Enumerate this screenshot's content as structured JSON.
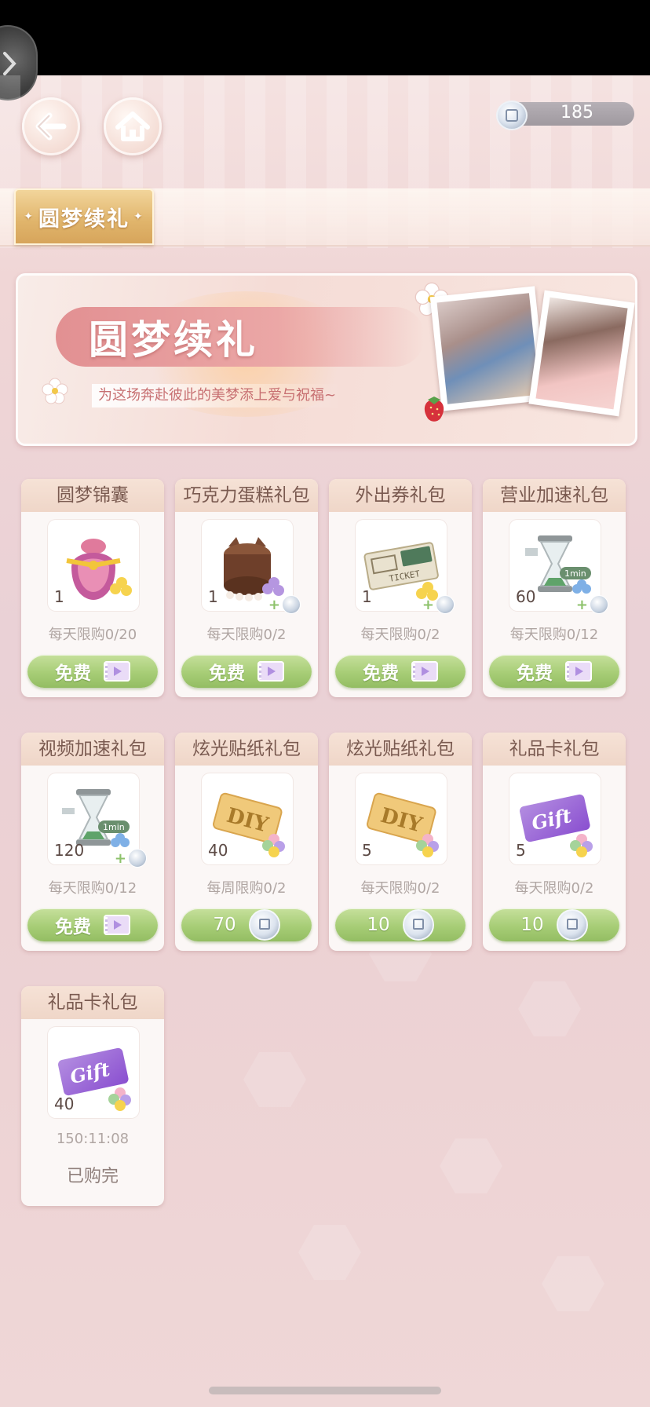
{
  "header": {
    "coins": "185"
  },
  "tab": {
    "active_label": "圆梦续礼"
  },
  "banner": {
    "title": "圆梦续礼",
    "subtitle": "为这场奔赴彼此的美梦添上爱与祝福~"
  },
  "cards": [
    {
      "title": "圆梦锦囊",
      "count": "1",
      "limit": "每天限购0/20",
      "action": "免费",
      "action_type": "video",
      "bonus": false
    },
    {
      "title": "巧克力蛋糕礼包",
      "count": "1",
      "limit": "每天限购0/2",
      "action": "免费",
      "action_type": "video",
      "bonus": true
    },
    {
      "title": "外出券礼包",
      "count": "1",
      "limit": "每天限购0/2",
      "action": "免费",
      "action_type": "video",
      "bonus": true
    },
    {
      "title": "营业加速礼包",
      "count": "60",
      "limit": "每天限购0/12",
      "action": "免费",
      "action_type": "video",
      "bonus": true
    },
    {
      "title": "视频加速礼包",
      "count": "120",
      "limit": "每天限购0/12",
      "action": "免费",
      "action_type": "video",
      "bonus": true
    },
    {
      "title": "炫光贴纸礼包",
      "count": "40",
      "limit": "每周限购0/2",
      "action": "70",
      "action_type": "coin",
      "bonus": false
    },
    {
      "title": "炫光贴纸礼包",
      "count": "5",
      "limit": "每天限购0/2",
      "action": "10",
      "action_type": "coin",
      "bonus": false
    },
    {
      "title": "礼品卡礼包",
      "count": "5",
      "limit": "每天限购0/2",
      "action": "10",
      "action_type": "coin",
      "bonus": false
    },
    {
      "title": "礼品卡礼包",
      "count": "40",
      "timer": "150:11:08",
      "status": "已购完",
      "action_type": "sold",
      "bonus": false
    }
  ],
  "item_art": {
    "hourglass_label": "1min",
    "ticket_label": "TICKET",
    "diy_label": "DIY",
    "gift_label": "Gift"
  },
  "icons": {
    "back": "back-arrow-icon",
    "home": "home-icon",
    "coin": "coin-icon",
    "video": "video-ad-icon"
  },
  "colors": {
    "button_green": "#a7cd76",
    "tab_gold": "#e0b46b",
    "banner_pink": "#e29092"
  }
}
